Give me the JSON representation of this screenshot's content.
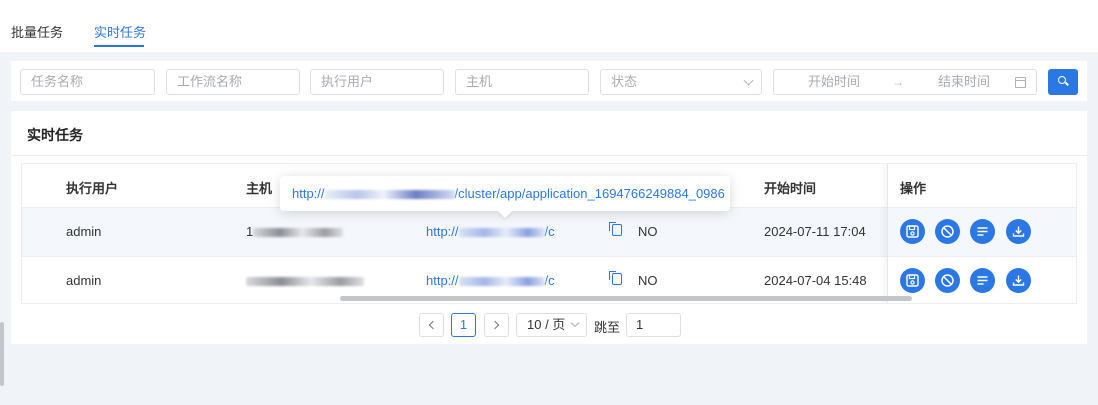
{
  "tabs": [
    {
      "label": "批量任务",
      "active": false
    },
    {
      "label": "实时任务",
      "active": true
    }
  ],
  "filters": {
    "task_name_placeholder": "任务名称",
    "workflow_name_placeholder": "工作流名称",
    "exec_user_placeholder": "执行用户",
    "host_placeholder": "主机",
    "status_placeholder": "状态",
    "start_time_placeholder": "开始时间",
    "end_time_placeholder": "结束时间",
    "range_arrow": "→"
  },
  "card": {
    "title": "实时任务"
  },
  "table": {
    "columns": {
      "user": "执行用户",
      "host": "主机",
      "start_time": "开始时间",
      "ops": "操作"
    },
    "rows": [
      {
        "user": "admin",
        "host_prefix": "1",
        "host_suffix": "",
        "link_prefix": "http://",
        "link_suffix": "/c",
        "flag": "NO",
        "start_time": "2024-07-11 17:04"
      },
      {
        "user": "admin",
        "host_prefix": "",
        "host_suffix": "",
        "link_prefix": "http://",
        "link_suffix": "/c",
        "flag": "NO",
        "start_time": "2024-07-04 15:48"
      }
    ]
  },
  "tooltip": {
    "prefix": "http://",
    "suffix": "/cluster/app/application_1694766249884_0986"
  },
  "pagination": {
    "current_page": "1",
    "page_size": "10 / 页",
    "jump_label": "跳至",
    "jump_value": "1"
  },
  "colors": {
    "accent": "#2b78e4"
  }
}
